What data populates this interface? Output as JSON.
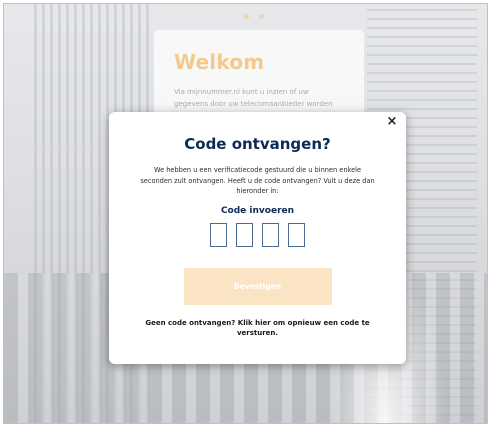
{
  "background": {
    "welcome_title": "Welkom",
    "welcome_text": "Via mijnnummer.nl kunt u inzien of uw gegevens door uw telecomaanbieder worden"
  },
  "modal": {
    "title": "Code ontvangen?",
    "description": "We hebben u een verificatiecode gestuurd die u binnen enkele seconden zult ontvangen. Heeft u de code ontvangen? Vult u deze dan hieronder in:",
    "code_label": "Code invoeren",
    "code_digits": [
      "",
      "",
      "",
      ""
    ],
    "confirm_label": "Bevestigen",
    "resend_text": "Geen code ontvangen? Klik hier om opnieuw een code te versturen.",
    "close_glyph": "×"
  },
  "colors": {
    "accent": "#f4c98c",
    "title": "#0d2a57",
    "button_disabled": "#fbe4c4"
  }
}
